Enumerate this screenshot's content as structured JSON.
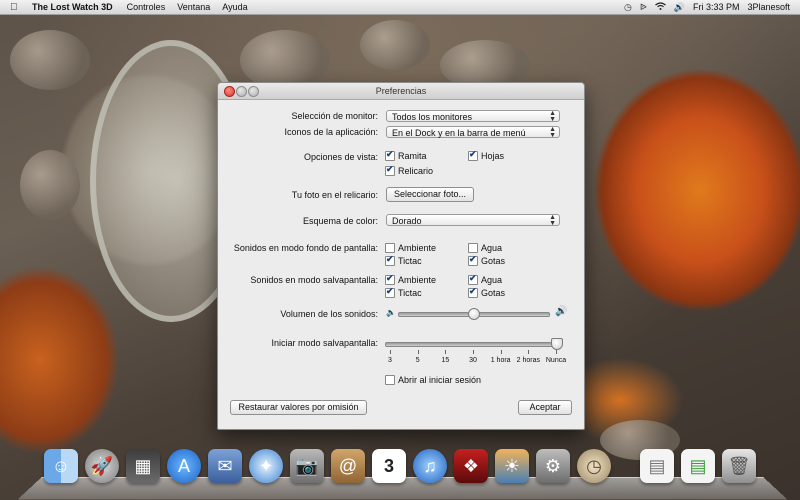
{
  "menubar": {
    "app_name": "The Lost Watch 3D",
    "menus": [
      "Controles",
      "Ventana",
      "Ayuda"
    ],
    "clock": "Fri 3:33 PM",
    "user": "3Planesoft",
    "status_icons": [
      "time-machine-icon",
      "bluetooth-icon",
      "wifi-icon",
      "volume-icon"
    ]
  },
  "window": {
    "title": "Preferencias",
    "monitor_label": "Selección de monitor:",
    "monitor_value": "Todos los monitores",
    "app_icons_label": "Iconos de la aplicación:",
    "app_icons_value": "En el Dock y en la barra de menú",
    "view_options_label": "Opciones de vista:",
    "view_options": [
      {
        "label": "Ramita",
        "checked": true
      },
      {
        "label": "Hojas",
        "checked": true
      },
      {
        "label": "Relicario",
        "checked": true
      }
    ],
    "photo_label": "Tu foto en el relicario:",
    "photo_button": "Seleccionar foto...",
    "color_scheme_label": "Esquema de color:",
    "color_scheme_value": "Dorado",
    "wallpaper_sounds_label": "Sonidos en modo fondo de pantalla:",
    "wallpaper_sounds": [
      {
        "label": "Ambiente",
        "checked": false
      },
      {
        "label": "Agua",
        "checked": false
      },
      {
        "label": "Tictac",
        "checked": true
      },
      {
        "label": "Gotas",
        "checked": true
      }
    ],
    "screensaver_sounds_label": "Sonidos en modo salvapantalla:",
    "screensaver_sounds": [
      {
        "label": "Ambiente",
        "checked": true
      },
      {
        "label": "Agua",
        "checked": true
      },
      {
        "label": "Tictac",
        "checked": true
      },
      {
        "label": "Gotas",
        "checked": true
      }
    ],
    "volume_label": "Volumen de los sonidos:",
    "volume_level": 0.5,
    "screensaver_start_label": "Iniciar modo salvapantalla:",
    "screensaver_start_ticks": [
      "3",
      "5",
      "15",
      "30",
      "1 hora",
      "2 horas",
      "Nunca"
    ],
    "screensaver_start_value": "Nunca",
    "login_label": "Abrir al iniciar sesión",
    "login_checked": false,
    "restore_button": "Restaurar valores por omisión",
    "accept_button": "Aceptar"
  },
  "dock": {
    "items": [
      "finder-icon",
      "launchpad-icon",
      "mission-control-icon",
      "app-store-icon",
      "mail-icon",
      "safari-icon",
      "facetime-icon",
      "contacts-icon",
      "calendar-icon",
      "itunes-icon",
      "photo-booth-icon",
      "iphoto-icon",
      "system-preferences-icon",
      "lost-watch-icon",
      "document-icon",
      "document-2-icon",
      "trash-icon"
    ],
    "calendar_day": "3"
  }
}
